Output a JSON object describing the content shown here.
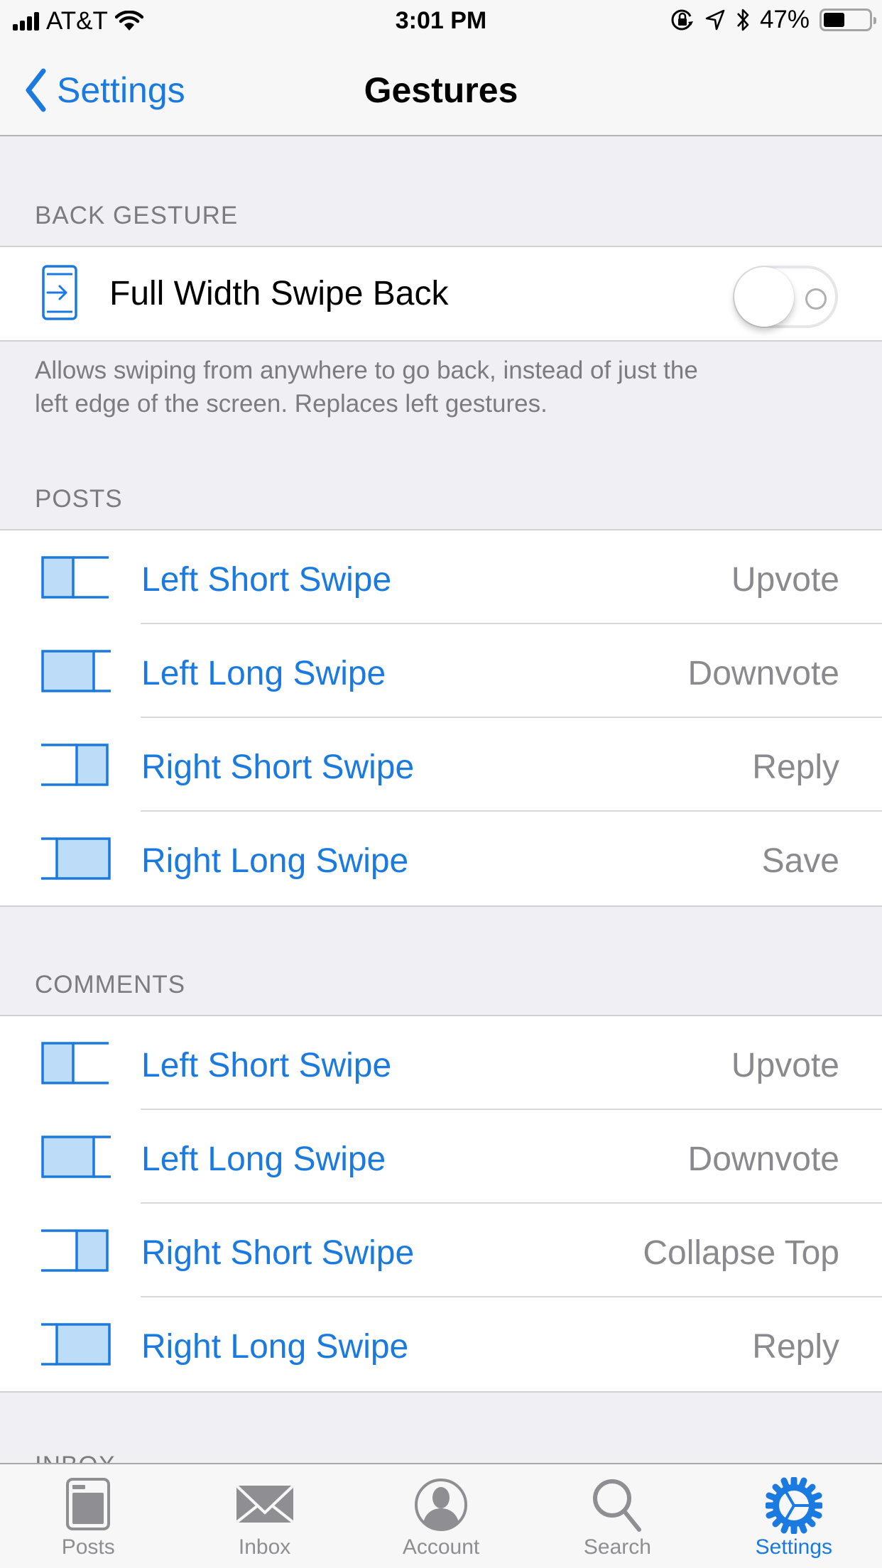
{
  "status_bar": {
    "carrier": "AT&T",
    "time": "3:01 PM",
    "battery_percent": "47%",
    "battery_level": 0.47,
    "icons": [
      "signal-icon",
      "wifi-icon",
      "rotation-lock-icon",
      "location-icon",
      "bluetooth-icon",
      "battery-icon"
    ]
  },
  "nav": {
    "back_label": "Settings",
    "title": "Gestures"
  },
  "colors": {
    "accent": "#1a7ae0",
    "icon_fill": "#bcdcf7",
    "secondary_text": "#8a8a8e",
    "background": "#efeff4"
  },
  "back_gesture": {
    "header": "BACK GESTURE",
    "toggle_label": "Full Width Swipe Back",
    "toggle_on": false,
    "footer_line1": "Allows swiping from anywhere to go back, instead of just the",
    "footer_line2": "left edge of the screen. Replaces left gestures."
  },
  "posts": {
    "header": "POSTS",
    "rows": [
      {
        "label": "Left Short Swipe",
        "value": "Upvote",
        "icon": "left-short-swipe-icon"
      },
      {
        "label": "Left Long Swipe",
        "value": "Downvote",
        "icon": "left-long-swipe-icon"
      },
      {
        "label": "Right Short Swipe",
        "value": "Reply",
        "icon": "right-short-swipe-icon"
      },
      {
        "label": "Right Long Swipe",
        "value": "Save",
        "icon": "right-long-swipe-icon"
      }
    ]
  },
  "comments": {
    "header": "COMMENTS",
    "rows": [
      {
        "label": "Left Short Swipe",
        "value": "Upvote",
        "icon": "left-short-swipe-icon"
      },
      {
        "label": "Left Long Swipe",
        "value": "Downvote",
        "icon": "left-long-swipe-icon"
      },
      {
        "label": "Right Short Swipe",
        "value": "Collapse Top",
        "icon": "right-short-swipe-icon"
      },
      {
        "label": "Right Long Swipe",
        "value": "Reply",
        "icon": "right-long-swipe-icon"
      }
    ]
  },
  "inbox_header_peek": "INBOX",
  "tab_bar": {
    "tabs": [
      {
        "label": "Posts",
        "icon": "posts-icon",
        "active": false
      },
      {
        "label": "Inbox",
        "icon": "envelope-icon",
        "active": false
      },
      {
        "label": "Account",
        "icon": "account-icon",
        "active": false
      },
      {
        "label": "Search",
        "icon": "search-icon",
        "active": false
      },
      {
        "label": "Settings",
        "icon": "gear-icon",
        "active": true
      }
    ]
  }
}
